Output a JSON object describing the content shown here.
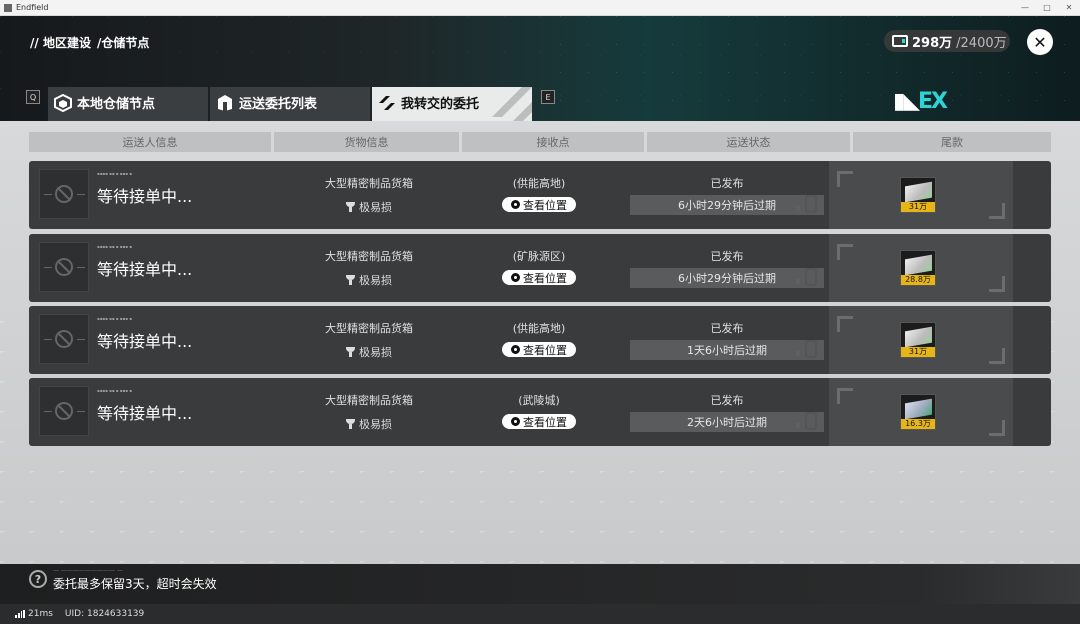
{
  "window": {
    "title": "Endfield"
  },
  "header": {
    "breadcrumb": [
      "// 地区建设",
      "/仓储节点"
    ],
    "currency": {
      "current": "298万",
      "max": "/2400万"
    },
    "brand": {
      "letters": "EX"
    }
  },
  "tabs": [
    {
      "label": "本地仓储节点",
      "key": "Q",
      "active": false
    },
    {
      "label": "运送委托列表",
      "active": false
    },
    {
      "label": "我转交的委托",
      "key": "E",
      "active": true
    }
  ],
  "columns": [
    "运送人信息",
    "货物信息",
    "接收点",
    "运送状态",
    "尾款"
  ],
  "rows": [
    {
      "courier": "等待接单中...",
      "cargo": "大型精密制品货箱",
      "fragility": "极易损",
      "location": "(供能高地)",
      "locate_label": "查看位置",
      "status": "已发布",
      "expire": "6小时29分钟后过期",
      "reward": "31万"
    },
    {
      "courier": "等待接单中...",
      "cargo": "大型精密制品货箱",
      "fragility": "极易损",
      "location": "(矿脉源区)",
      "locate_label": "查看位置",
      "status": "已发布",
      "expire": "6小时29分钟后过期",
      "reward": "28.8万"
    },
    {
      "courier": "等待接单中...",
      "cargo": "大型精密制品货箱",
      "fragility": "极易损",
      "location": "(供能高地)",
      "locate_label": "查看位置",
      "status": "已发布",
      "expire": "1天6小时后过期",
      "reward": "31万"
    },
    {
      "courier": "等待接单中...",
      "cargo": "大型精密制品货箱",
      "fragility": "极易损",
      "location": "(武陵城)",
      "locate_label": "查看位置",
      "status": "已发布",
      "expire": "2天6小时后过期",
      "reward": "16.3万"
    }
  ],
  "footer": {
    "help_text": "委托最多保留3天，超时会失效"
  },
  "statusbar": {
    "ping": "21ms",
    "uid": "UID: 1824633139"
  },
  "colors": {
    "accent": "#2ed3d6",
    "reward_badge": "#e8b517",
    "row_bg": "#3a3b3c"
  }
}
